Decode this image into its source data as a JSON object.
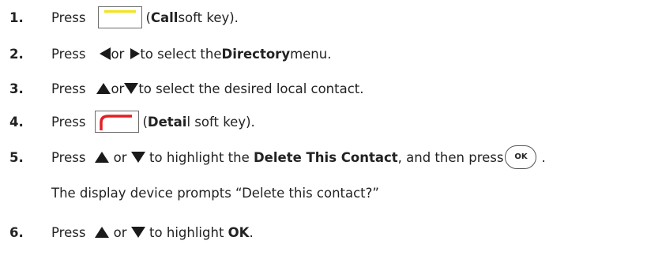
{
  "steps": [
    {
      "num": "1.",
      "press": "Press",
      "open_paren": "(",
      "key_name": "Call",
      "rest": " soft key)."
    },
    {
      "num": "2.",
      "press": "Press",
      "or": "or",
      "rest_a": " to select the ",
      "bold": "Directory",
      "rest_b": " menu."
    },
    {
      "num": "3.",
      "press": "Press",
      "or": "or",
      "rest": " to select the desired local contact."
    },
    {
      "num": "4.",
      "press": "Press",
      "open_paren": " (",
      "key_bold": "Detai",
      "key_rest": "l soft key)."
    },
    {
      "num": "5.",
      "press": "Press",
      "or": " or ",
      "rest_a": " to highlight the ",
      "bold": "Delete This Contact",
      "rest_b": ", and then press",
      "ok_label": "OK",
      "end": "."
    },
    {
      "note": "The display device prompts “Delete this contact?”"
    },
    {
      "num": "6.",
      "press": "Press",
      "or": " or ",
      "rest_a": " to highlight ",
      "bold": "OK",
      "rest_b": "."
    }
  ],
  "colors": {
    "text": "#222222",
    "call_key_bar": "#f2e21a",
    "detail_key_arc": "#e31e24",
    "arrow": "#1a1a1a"
  },
  "icons": [
    "call-softkey-icon",
    "left-arrow-icon",
    "right-arrow-icon",
    "up-arrow-icon",
    "down-arrow-icon",
    "detail-softkey-icon",
    "ok-button-icon"
  ]
}
